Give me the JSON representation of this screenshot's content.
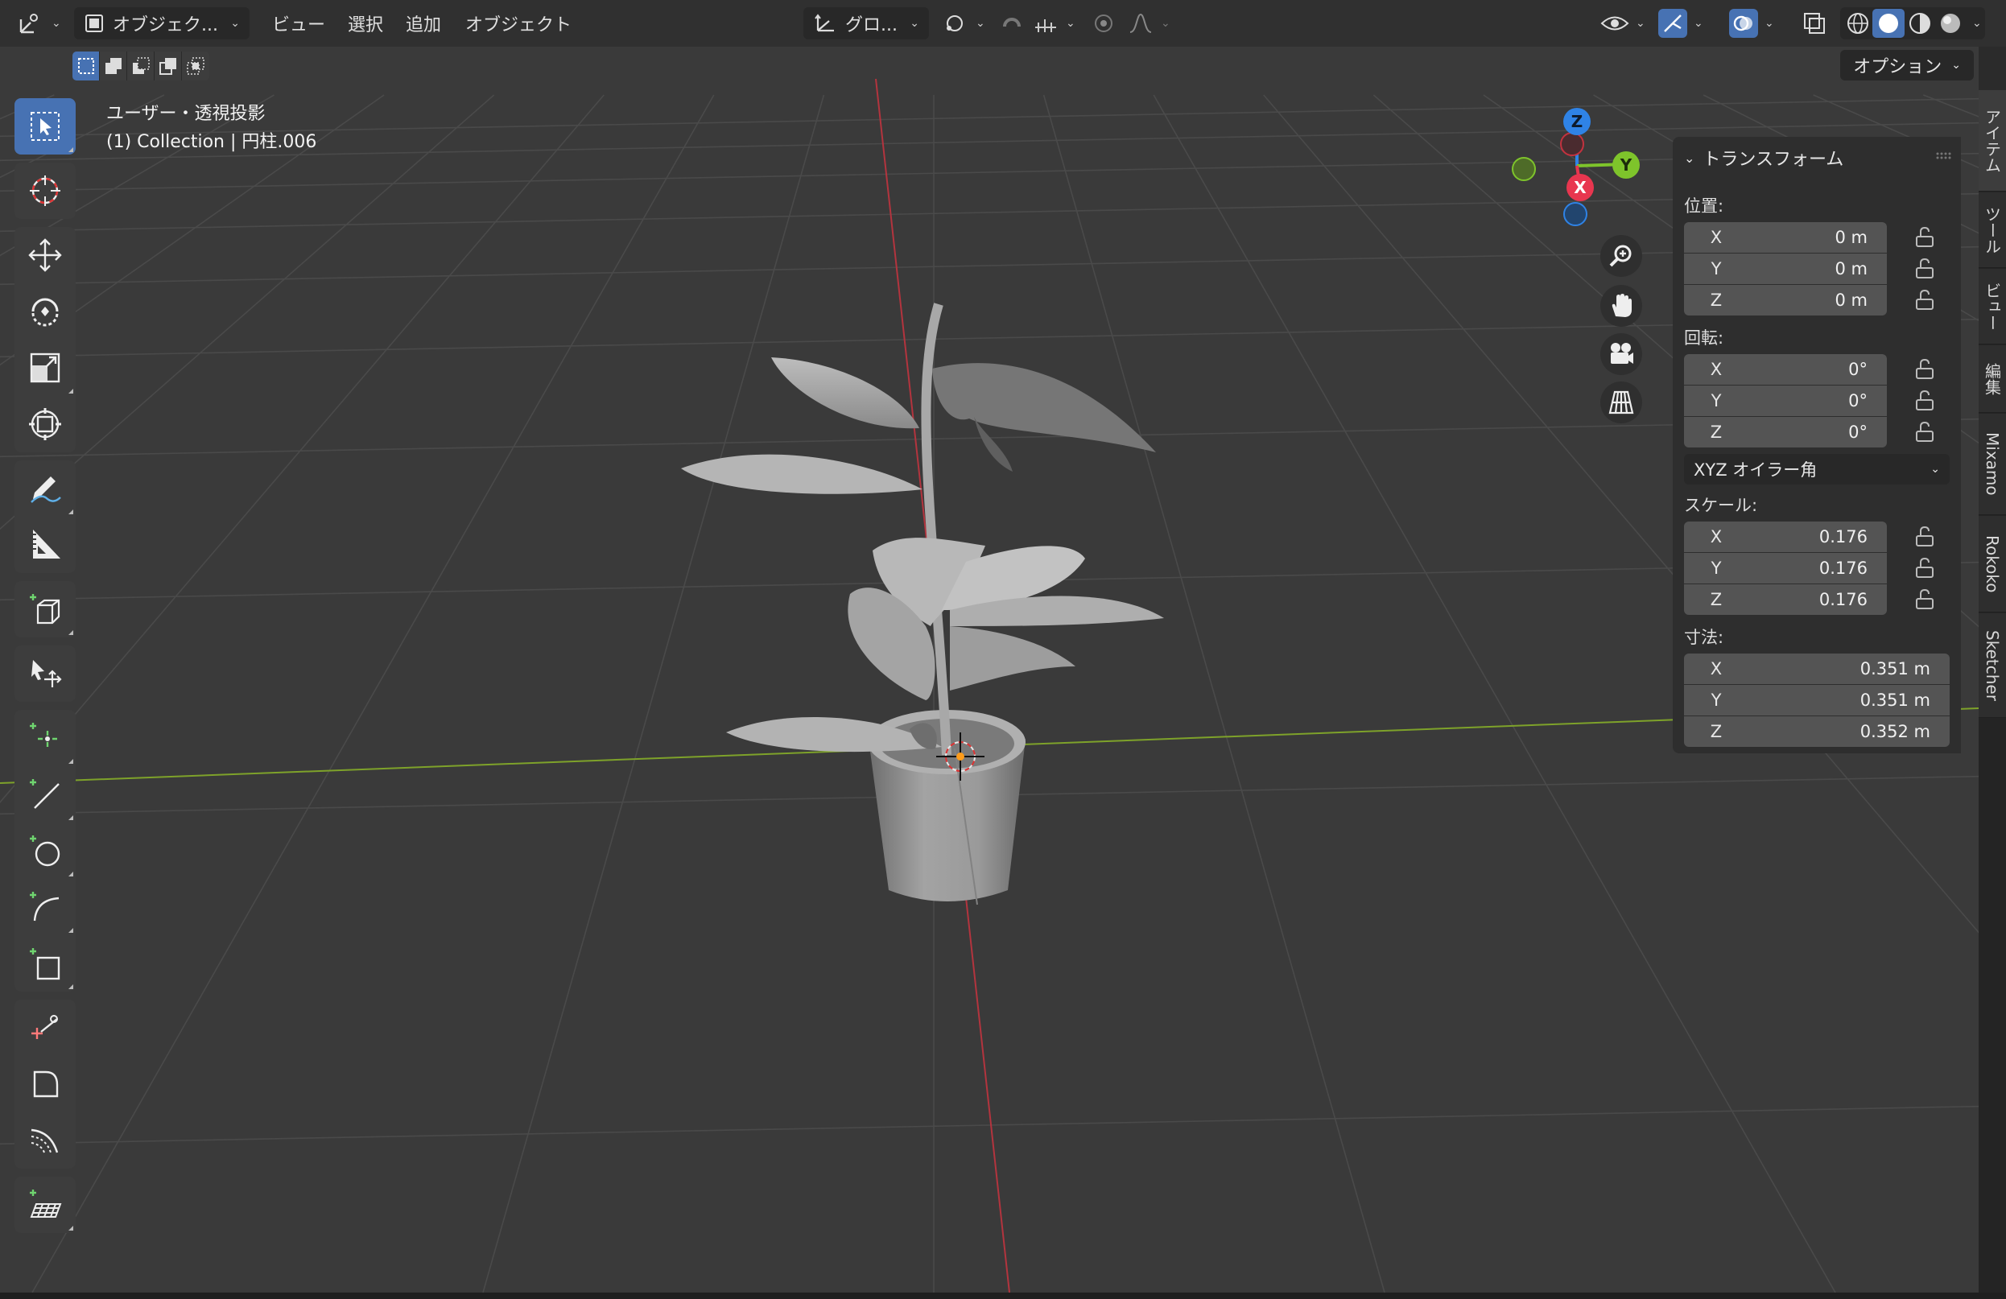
{
  "header": {
    "mode_label": "オブジェク...",
    "menus": [
      "ビュー",
      "選択",
      "追加",
      "オブジェクト"
    ],
    "transform_orientation": "グロ...",
    "options_label": "オプション"
  },
  "viewport": {
    "view_name": "ユーザー・透視投影",
    "collection_info": "(1) Collection | 円柱.006"
  },
  "gizmo": {
    "z_label": "Z",
    "y_label": "Y",
    "x_label": "X",
    "colors": {
      "x": "#e8364f",
      "y": "#7ec42b",
      "z": "#2f83e6"
    }
  },
  "transform_panel": {
    "title": "トランスフォーム",
    "location": {
      "label": "位置:",
      "x": {
        "axis": "X",
        "value": "0 m"
      },
      "y": {
        "axis": "Y",
        "value": "0 m"
      },
      "z": {
        "axis": "Z",
        "value": "0 m"
      }
    },
    "rotation": {
      "label": "回転:",
      "x": {
        "axis": "X",
        "value": "0°"
      },
      "y": {
        "axis": "Y",
        "value": "0°"
      },
      "z": {
        "axis": "Z",
        "value": "0°"
      },
      "mode": "XYZ オイラー角"
    },
    "scale": {
      "label": "スケール:",
      "x": {
        "axis": "X",
        "value": "0.176"
      },
      "y": {
        "axis": "Y",
        "value": "0.176"
      },
      "z": {
        "axis": "Z",
        "value": "0.176"
      }
    },
    "dimensions": {
      "label": "寸法:",
      "x": {
        "axis": "X",
        "value": "0.351 m"
      },
      "y": {
        "axis": "Y",
        "value": "0.351 m"
      },
      "z": {
        "axis": "Z",
        "value": "0.352 m"
      }
    }
  },
  "sidebar_tabs": [
    "アイテム",
    "ツール",
    "ビュー",
    "編集",
    "Mixamo",
    "Rokoko",
    "Sketcher"
  ],
  "accent_color": "#4772b3"
}
